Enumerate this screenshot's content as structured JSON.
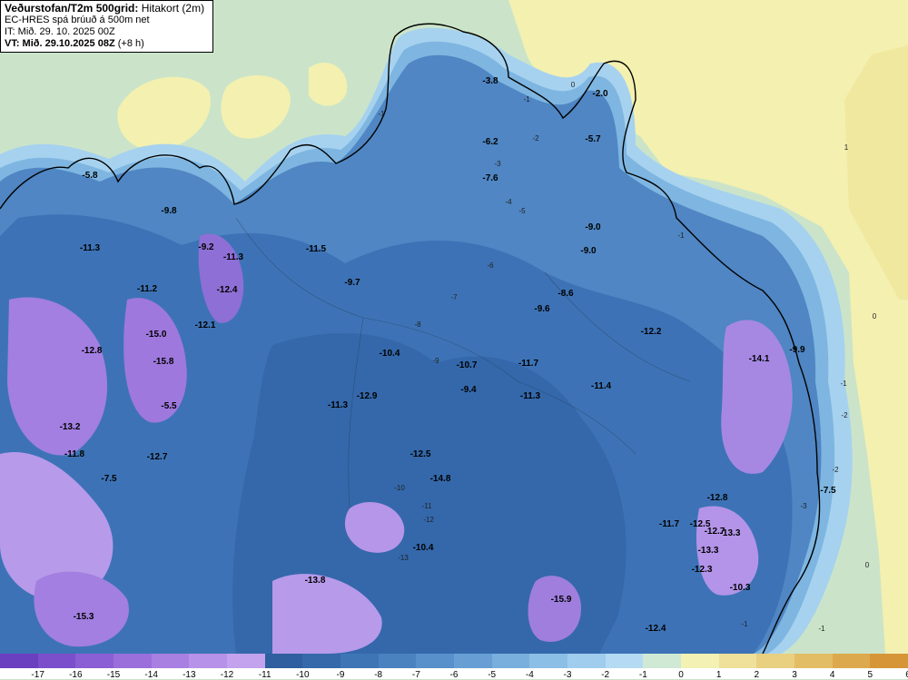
{
  "header": {
    "title": "Veðurstofan/T2m 500grid:",
    "subtitle": "Hitakort (2m)",
    "model": "EC-HRES spá brúuð á 500m net",
    "init_time": "IT: Mið. 29. 10. 2025 00Z",
    "valid_time": "VT: Mið. 29.10.2025 08Z",
    "lead": "(+8 h)"
  },
  "legend": {
    "ticks": [
      "-17",
      "-16",
      "-15",
      "-14",
      "-13",
      "-12",
      "-11",
      "-10",
      "-9",
      "-8",
      "-7",
      "-6",
      "-5",
      "-4",
      "-3",
      "-2",
      "-1",
      "0",
      "1",
      "2",
      "3",
      "4",
      "5",
      "6"
    ],
    "colors": [
      "#6a3fc0",
      "#7b4fcb",
      "#8a5ed4",
      "#9a6fdc",
      "#a880e2",
      "#b692e8",
      "#c3a3ee",
      "#2f5f9e",
      "#3569aa",
      "#3e75b5",
      "#4a82c0",
      "#5890cb",
      "#679fd4",
      "#79afdd",
      "#8cbfe6",
      "#a0cdee",
      "#b5dbf4",
      "#cfe9d4",
      "#f3f1b4",
      "#efe09a",
      "#e9cf80",
      "#e3bd66",
      "#dca94e",
      "#d69638"
    ]
  },
  "temps": [
    "-3.8",
    "-2.0",
    "-5.7",
    "-6.2",
    "-7.6",
    "-5.8",
    "-9.8",
    "-11.3",
    "-9.2",
    "-11.5",
    "-9.0",
    "-9.0",
    "-9.7",
    "-11.3",
    "-11.2",
    "-12.4",
    "-8.6",
    "-9.6",
    "-12.1",
    "-12.2",
    "-15.0",
    "-12.8",
    "-10.4",
    "-10.7",
    "-11.7",
    "-15.8",
    "-9.4",
    "-11.4",
    "-14.1",
    "-9.9",
    "-11.3",
    "-12.9",
    "-11.3",
    "-5.5",
    "-13.2",
    "-12.5",
    "-11.8",
    "-12.7",
    "-14.8",
    "-7.5",
    "-7.5",
    "-12.8",
    "-13.3",
    "-11.7",
    "-12.5",
    "-13.3",
    "-12.7",
    "-10.4",
    "-12.3",
    "-13.8",
    "-10.3",
    "-15.3",
    "-15.9",
    "-12.4"
  ],
  "contour_labels": [
    "0",
    "-1",
    "-1",
    "-2",
    "-3",
    "-4",
    "-5",
    "-6",
    "-7",
    "-8",
    "-9",
    "-10",
    "-11",
    "-12",
    "-13",
    "1",
    "0",
    "-1",
    "-1",
    "-2",
    "-2",
    "-3",
    "0",
    "-1",
    "-1"
  ]
}
